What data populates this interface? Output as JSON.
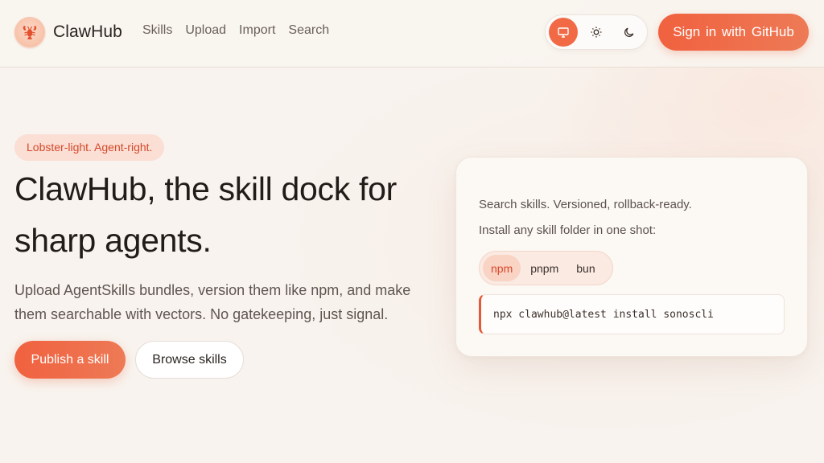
{
  "header": {
    "brand": "ClawHub",
    "nav": [
      "Skills",
      "Upload",
      "Import",
      "Search"
    ],
    "theme_options": [
      {
        "icon": "monitor-icon",
        "active": true
      },
      {
        "icon": "sun-icon",
        "active": false
      },
      {
        "icon": "moon-icon",
        "active": false
      }
    ],
    "signin_label": "Sign in  with GitHub"
  },
  "hero": {
    "tagline": "Lobster-light. Agent-right.",
    "title": "ClawHub, the skill dock for sharp agents.",
    "subtitle": "Upload AgentSkills bundles, version them like npm, and make them searchable with vectors. No gatekeeping, just signal.",
    "primary_cta": "Publish a skill",
    "secondary_cta": "Browse skills"
  },
  "install_card": {
    "line1": "Search skills. Versioned, rollback-ready.",
    "line2": "Install any skill folder in one shot:",
    "package_managers": [
      "npm",
      "pnpm",
      "bun"
    ],
    "selected_manager": "npm",
    "command": "npx clawhub@latest install sonoscli"
  },
  "colors": {
    "accent": "#f0613f",
    "background": "#f8f3ee",
    "tagline_bg": "#fbded4"
  }
}
